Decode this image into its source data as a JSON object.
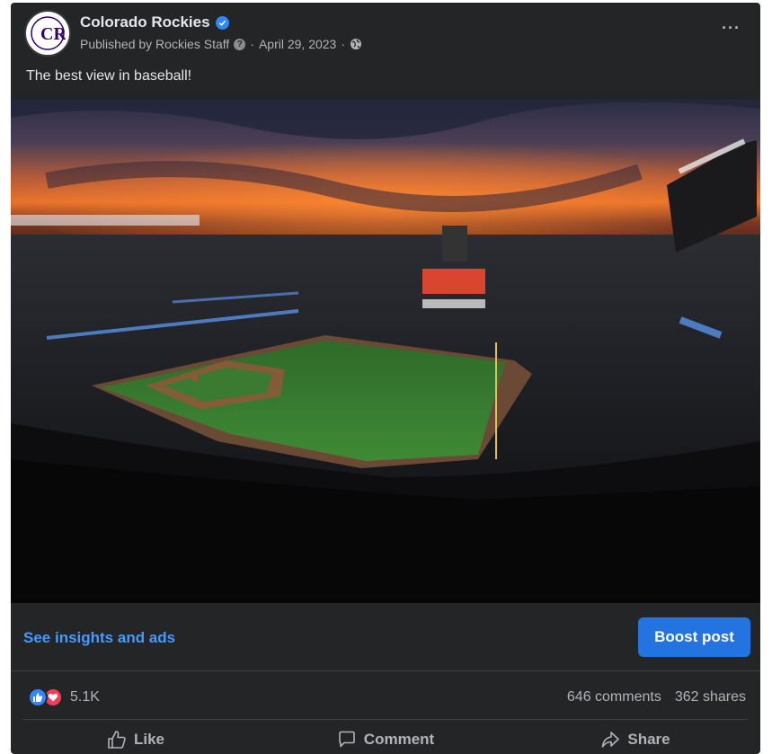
{
  "post": {
    "page_name": "Colorado Rockies",
    "verified_icon": "verified-badge-icon",
    "published_by": "Published by Rockies Staff",
    "date": "April 29, 2023",
    "separator": "·",
    "audience_icon": "globe-icon",
    "caption": "The best view in baseball!",
    "more_icon": "more-options-icon",
    "more_label": "···",
    "avatar_logo": "CR"
  },
  "photo": {
    "description_icon": "stadium-photo"
  },
  "insights": {
    "link_label": "See insights and ads",
    "boost_label": "Boost post"
  },
  "stats": {
    "reaction_count": "5.1K",
    "comments": "646 comments",
    "shares": "362 shares"
  },
  "actions": {
    "like": "Like",
    "comment": "Comment",
    "share": "Share"
  },
  "colors": {
    "card_bg": "#242526",
    "accent_blue": "#2374e1",
    "link_blue": "#4599ff",
    "secondary_text": "#b0b3b8"
  }
}
